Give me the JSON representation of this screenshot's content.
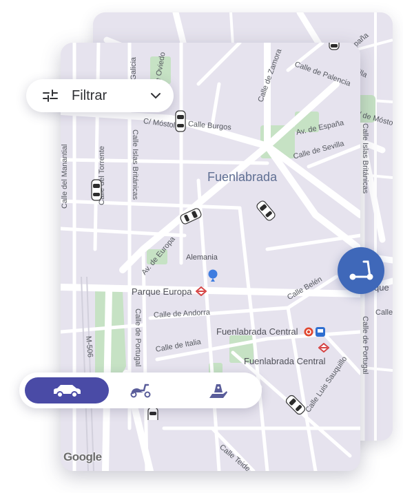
{
  "filter": {
    "label": "Filtrar"
  },
  "map": {
    "city": "Fuenlabrada",
    "places": {
      "parque_europa": "Parque Europa",
      "fuenlabrada_central_1": "Fuenlabrada Central",
      "fuenlabrada_central_2": "Fuenlabrada Central",
      "alemania": "Alemania"
    },
    "streets": {
      "mostoles": "C/ Móstoles",
      "burgos": "Calle Burgos",
      "galicia": "Calle de Galicia",
      "oviedo": "C/ de Oviedo",
      "zamora": "Calle de Zamora",
      "palencia": "Calle de Palencia",
      "espana": "Av. de España",
      "sevilla": "Calle de Sevilla",
      "manantial": "Calle del Manantial",
      "torrente": "Calle del Torrente",
      "islas_britanicas": "Calle Islas Británicas",
      "europa": "Av. de Europa",
      "belen": "Calle Belén",
      "andorra": "Calle de Andorra",
      "portugal": "Calle de Portugal",
      "italia": "Calle de Italia",
      "m506": "M-506",
      "luis_sauquillo": "Calle Luis Sauquillo",
      "teide": "Calle Teide",
      "back_mostoles": "C/ de Móstoles",
      "back_islas": "Calle Islas Británicas",
      "back_portugal": "Calle de Portugal",
      "back_villa": "villa",
      "back_espana": "España",
      "back_calle": "Calle",
      "back_que": "que"
    },
    "attribution": "Google"
  },
  "modes": [
    {
      "name": "car",
      "active": true
    },
    {
      "name": "scooter",
      "active": false
    },
    {
      "name": "kick-scooter",
      "active": false
    }
  ],
  "colors": {
    "accent": "#4a4ba6",
    "fab": "#3f68b9",
    "map_bg": "#e6e3ee",
    "park": "#c6e2c4"
  }
}
